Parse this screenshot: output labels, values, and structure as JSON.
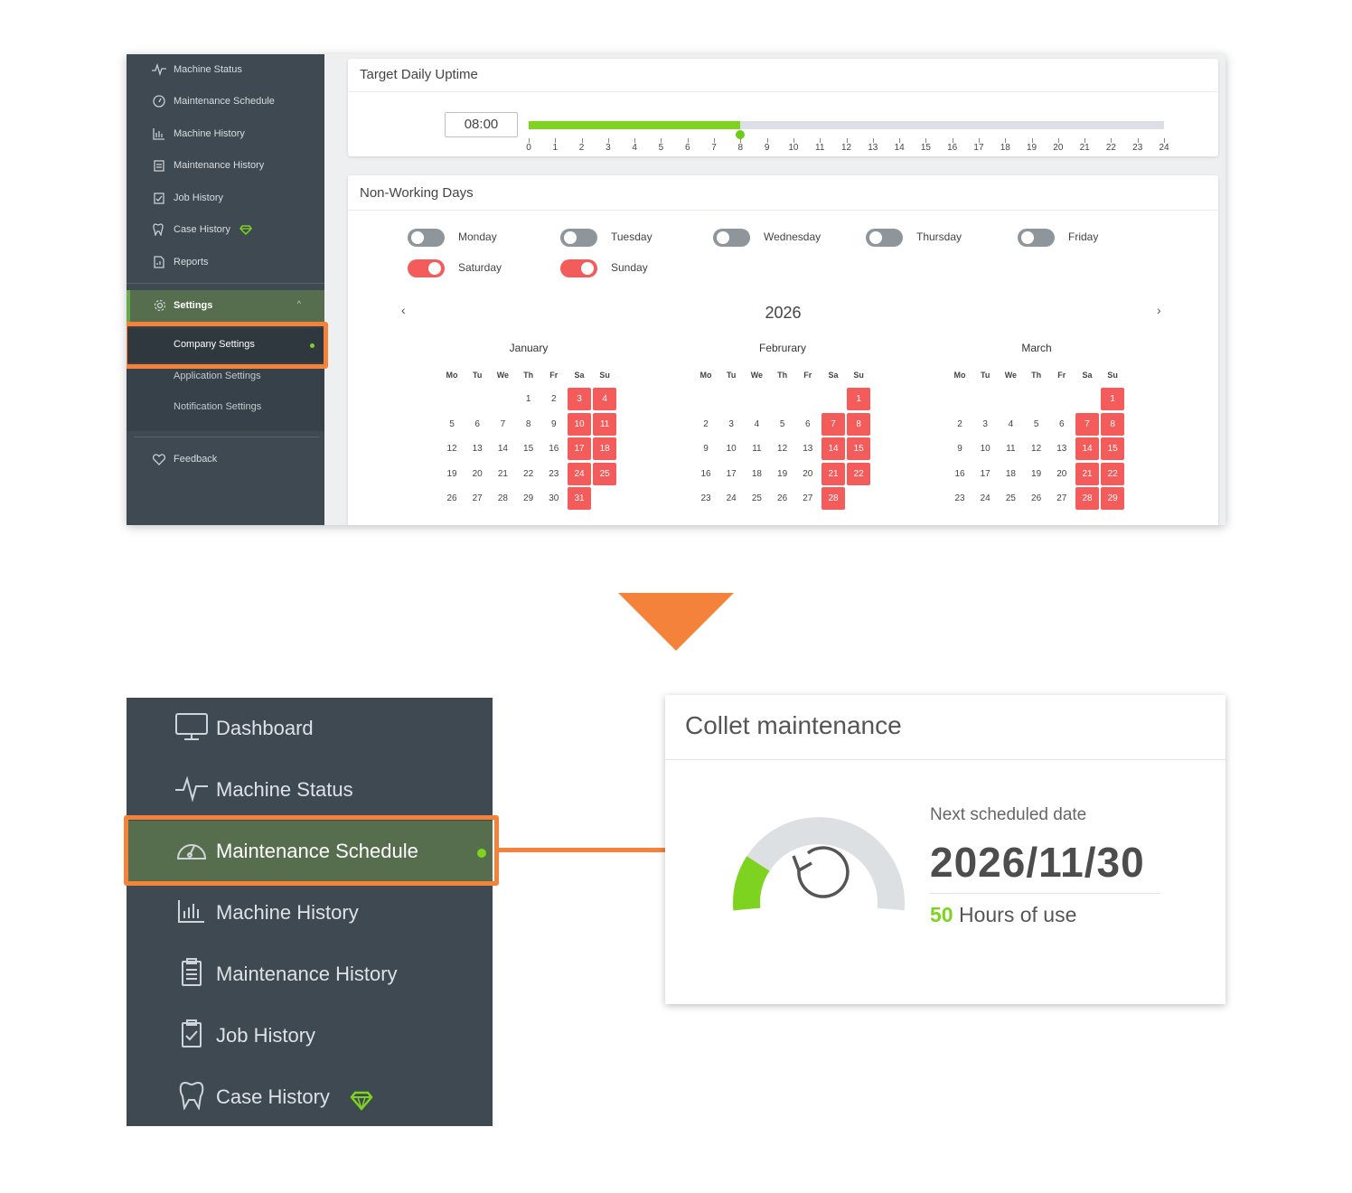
{
  "top_sidebar": {
    "items": [
      {
        "label": "Machine Status",
        "icon": "pulse-icon"
      },
      {
        "label": "Maintenance Schedule",
        "icon": "gauge-icon"
      },
      {
        "label": "Machine History",
        "icon": "bar-chart-icon"
      },
      {
        "label": "Maintenance History",
        "icon": "clipboard-list-icon"
      },
      {
        "label": "Job History",
        "icon": "clipboard-check-icon"
      },
      {
        "label": "Case History",
        "icon": "tooth-icon"
      },
      {
        "label": "Reports",
        "icon": "report-icon"
      }
    ],
    "settings_label": "Settings",
    "submenu": [
      "Company Settings",
      "Application Settings",
      "Notification Settings"
    ],
    "feedback_label": "Feedback"
  },
  "uptime": {
    "title": "Target Daily Uptime",
    "value": "08:00",
    "slider_value": 8,
    "slider_max": 24,
    "ticks": [
      "0",
      "1",
      "2",
      "3",
      "4",
      "5",
      "6",
      "7",
      "8",
      "9",
      "10",
      "11",
      "12",
      "13",
      "14",
      "15",
      "16",
      "17",
      "18",
      "19",
      "20",
      "21",
      "22",
      "23",
      "24"
    ]
  },
  "non_working": {
    "title": "Non-Working Days",
    "days": [
      {
        "label": "Monday",
        "on": false
      },
      {
        "label": "Tuesday",
        "on": false
      },
      {
        "label": "Wednesday",
        "on": false
      },
      {
        "label": "Thursday",
        "on": false
      },
      {
        "label": "Friday",
        "on": false
      },
      {
        "label": "Saturday",
        "on": true
      },
      {
        "label": "Sunday",
        "on": true
      }
    ],
    "year": "2026",
    "prev": "‹",
    "next": "›",
    "weekday_headers": [
      "Mo",
      "Tu",
      "We",
      "Th",
      "Fr",
      "Sa",
      "Su"
    ],
    "months": [
      {
        "name": "January",
        "offset": 3,
        "days": 31
      },
      {
        "name": "Februrary",
        "offset": 6,
        "days": 28
      },
      {
        "name": "March",
        "offset": 6,
        "days": 29
      }
    ]
  },
  "big_sidebar": {
    "items": [
      {
        "label": "Dashboard",
        "icon": "monitor-icon"
      },
      {
        "label": "Machine Status",
        "icon": "pulse-icon"
      },
      {
        "label": "Maintenance Schedule",
        "icon": "gauge-icon"
      },
      {
        "label": "Machine History",
        "icon": "bar-chart-icon"
      },
      {
        "label": "Maintenance History",
        "icon": "clipboard-list-icon"
      },
      {
        "label": "Job History",
        "icon": "clipboard-check-icon"
      },
      {
        "label": "Case History",
        "icon": "tooth-icon"
      }
    ]
  },
  "maintenance": {
    "title": "Collet maintenance",
    "next_label": "Next scheduled date",
    "next_date": "2026/11/30",
    "hours_value": "50",
    "hours_text": " Hours of use",
    "gauge_fraction": 0.2
  },
  "colors": {
    "sidebar_bg": "#3e4951",
    "active_bg": "#566e4e",
    "accent_green": "#7ed321",
    "highlight_orange": "#f5823a",
    "weekend_red": "#f45c5c"
  }
}
